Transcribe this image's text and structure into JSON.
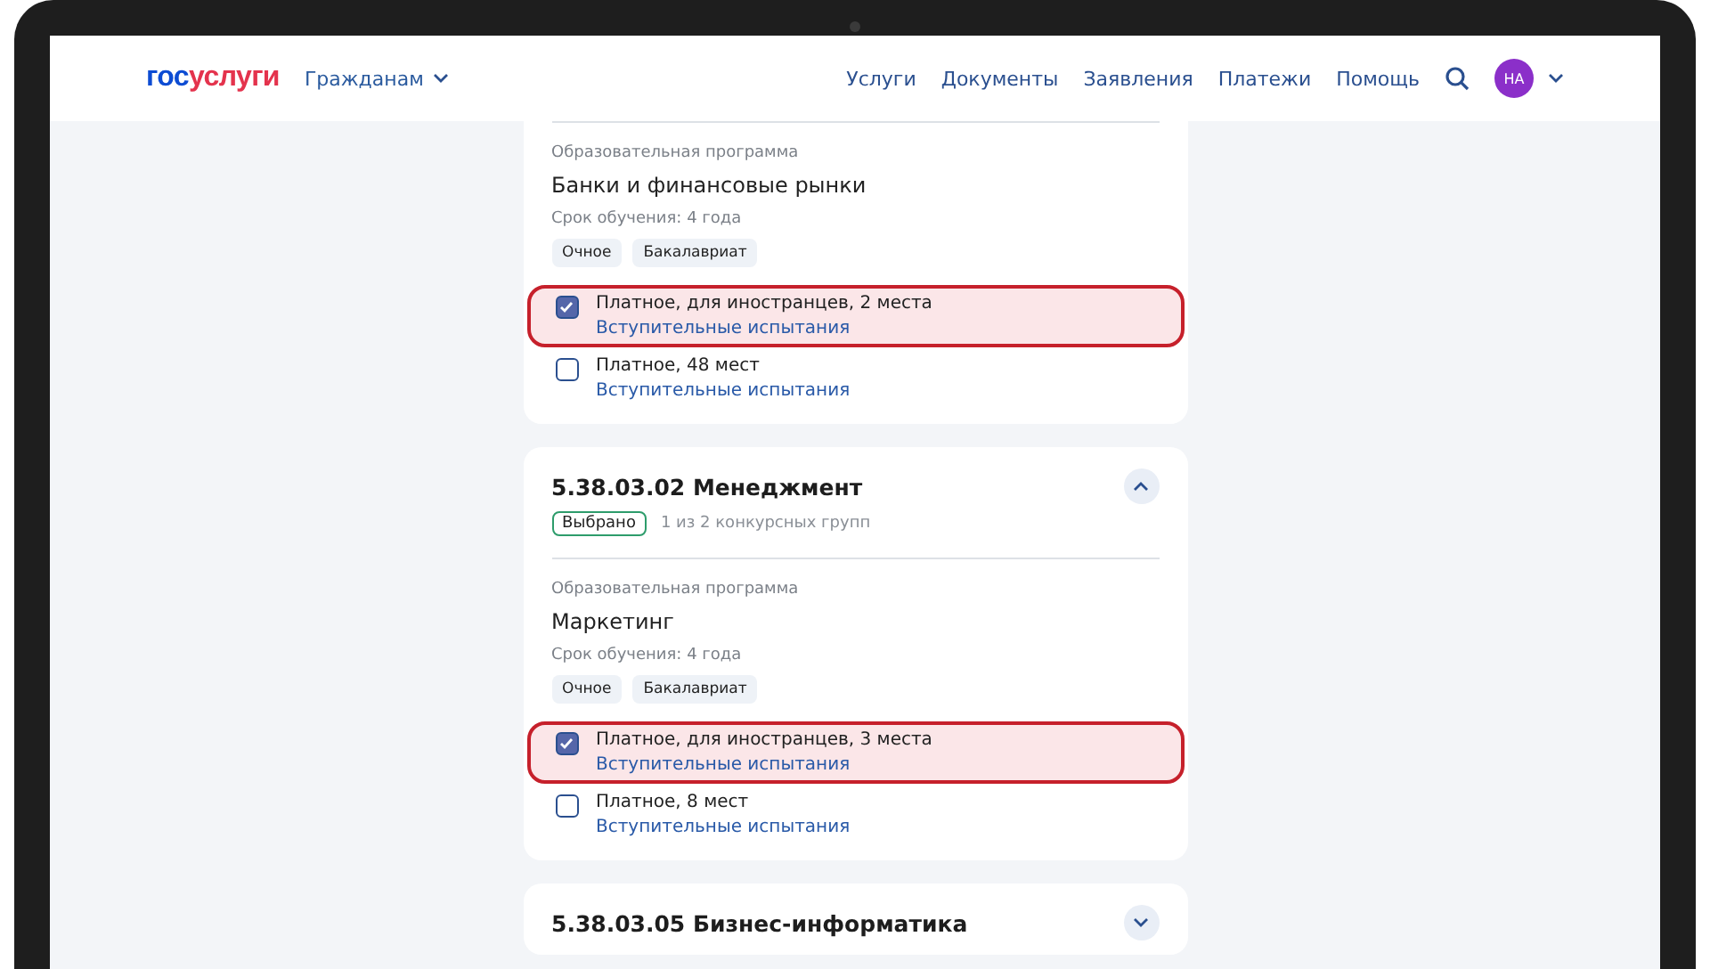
{
  "header": {
    "logo": {
      "part_1": "гос",
      "part_2": "услуги"
    },
    "audience": "Гражданам",
    "nav": [
      "Услуги",
      "Документы",
      "Заявления",
      "Платежи",
      "Помощь"
    ],
    "avatar": "НА"
  },
  "cards": [
    {
      "programs": [
        {
          "label": "Образовательная программа",
          "name": "Банки и финансовые рынки",
          "duration": "Срок обучения: 4 года",
          "tags": [
            "Очное",
            "Бакалавриат"
          ],
          "groups": [
            {
              "text": "Платное, для иностранцев, 2 места",
              "link": "Вступительные испытания",
              "checked": true,
              "highlighted": true
            },
            {
              "text": "Платное, 48 мест",
              "link": "Вступительные испытания",
              "checked": false,
              "highlighted": false
            }
          ]
        }
      ]
    },
    {
      "title": "5.38.03.02 Менеджмент",
      "expanded": true,
      "badge": "Выбрано",
      "note": "1 из 2 конкурсных групп",
      "programs": [
        {
          "label": "Образовательная программа",
          "name": "Маркетинг",
          "duration": "Срок обучения: 4 года",
          "tags": [
            "Очное",
            "Бакалавриат"
          ],
          "groups": [
            {
              "text": "Платное, для иностранцев, 3 места",
              "link": "Вступительные испытания",
              "checked": true,
              "highlighted": true
            },
            {
              "text": "Платное, 8 мест",
              "link": "Вступительные испытания",
              "checked": false,
              "highlighted": false
            }
          ]
        }
      ]
    },
    {
      "title": "5.38.03.05 Бизнес-информатика",
      "expanded": false
    }
  ]
}
